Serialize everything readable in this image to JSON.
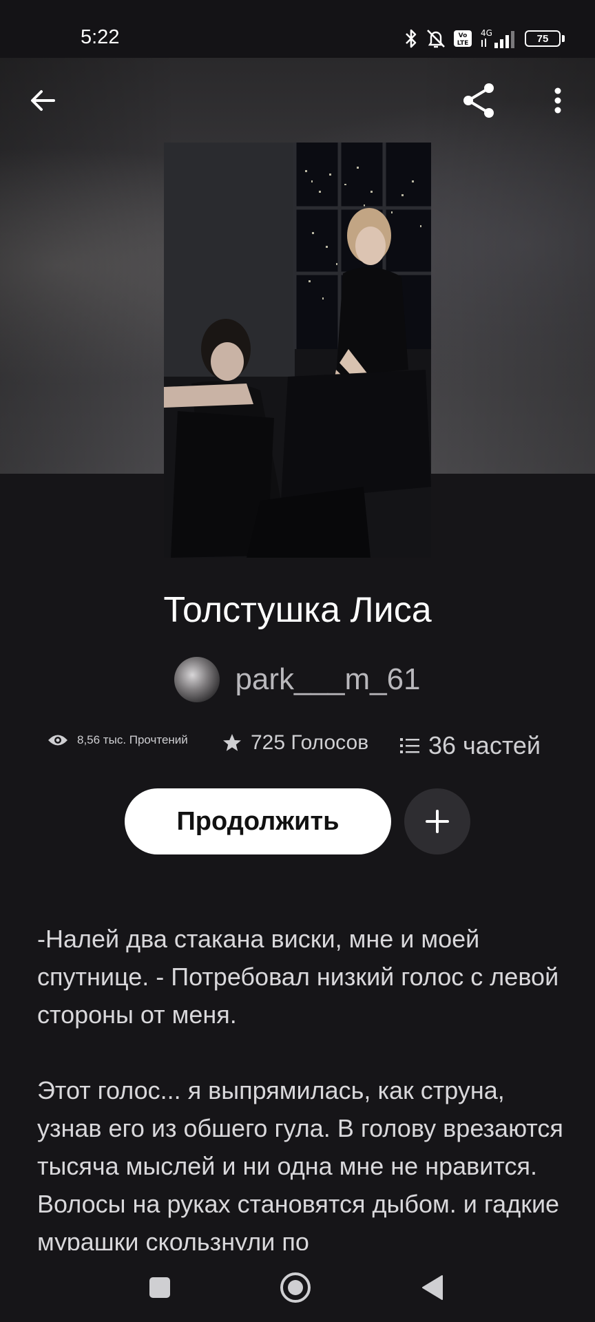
{
  "status_bar": {
    "time": "5:22",
    "network": "4G",
    "volte": "Vo LTE",
    "battery": "75"
  },
  "story": {
    "title": "Толстушка Лиса",
    "author": "park___m_61",
    "reads": "8,56 тыс. Прочтений",
    "votes": "725 Голосов",
    "parts": "36 частей"
  },
  "actions": {
    "continue_label": "Продолжить"
  },
  "description": {
    "paragraphs": [
      "-Налей два стакана виски, мне и моей спутнице. - Потребовал низкий голос с левой стороны от меня.",
      "Этот голос... я выпрямилась, как струна, узнав его из обшего гула. В голову врезаются тысяча мыслей и ни одна мне не нравится. Волосы на руках становятся дыбом. и гадкие мурашки скользнули по"
    ]
  },
  "icons": {
    "back": "arrow-left-icon",
    "share": "share-icon",
    "more": "more-vertical-icon",
    "reads": "eye-icon",
    "votes": "star-icon",
    "parts": "list-icon",
    "add": "plus-icon"
  },
  "colors": {
    "background": "#161518",
    "continue_button": "#ffffff",
    "add_button": "#2e2d31",
    "muted_text": "#b9b8bc"
  }
}
